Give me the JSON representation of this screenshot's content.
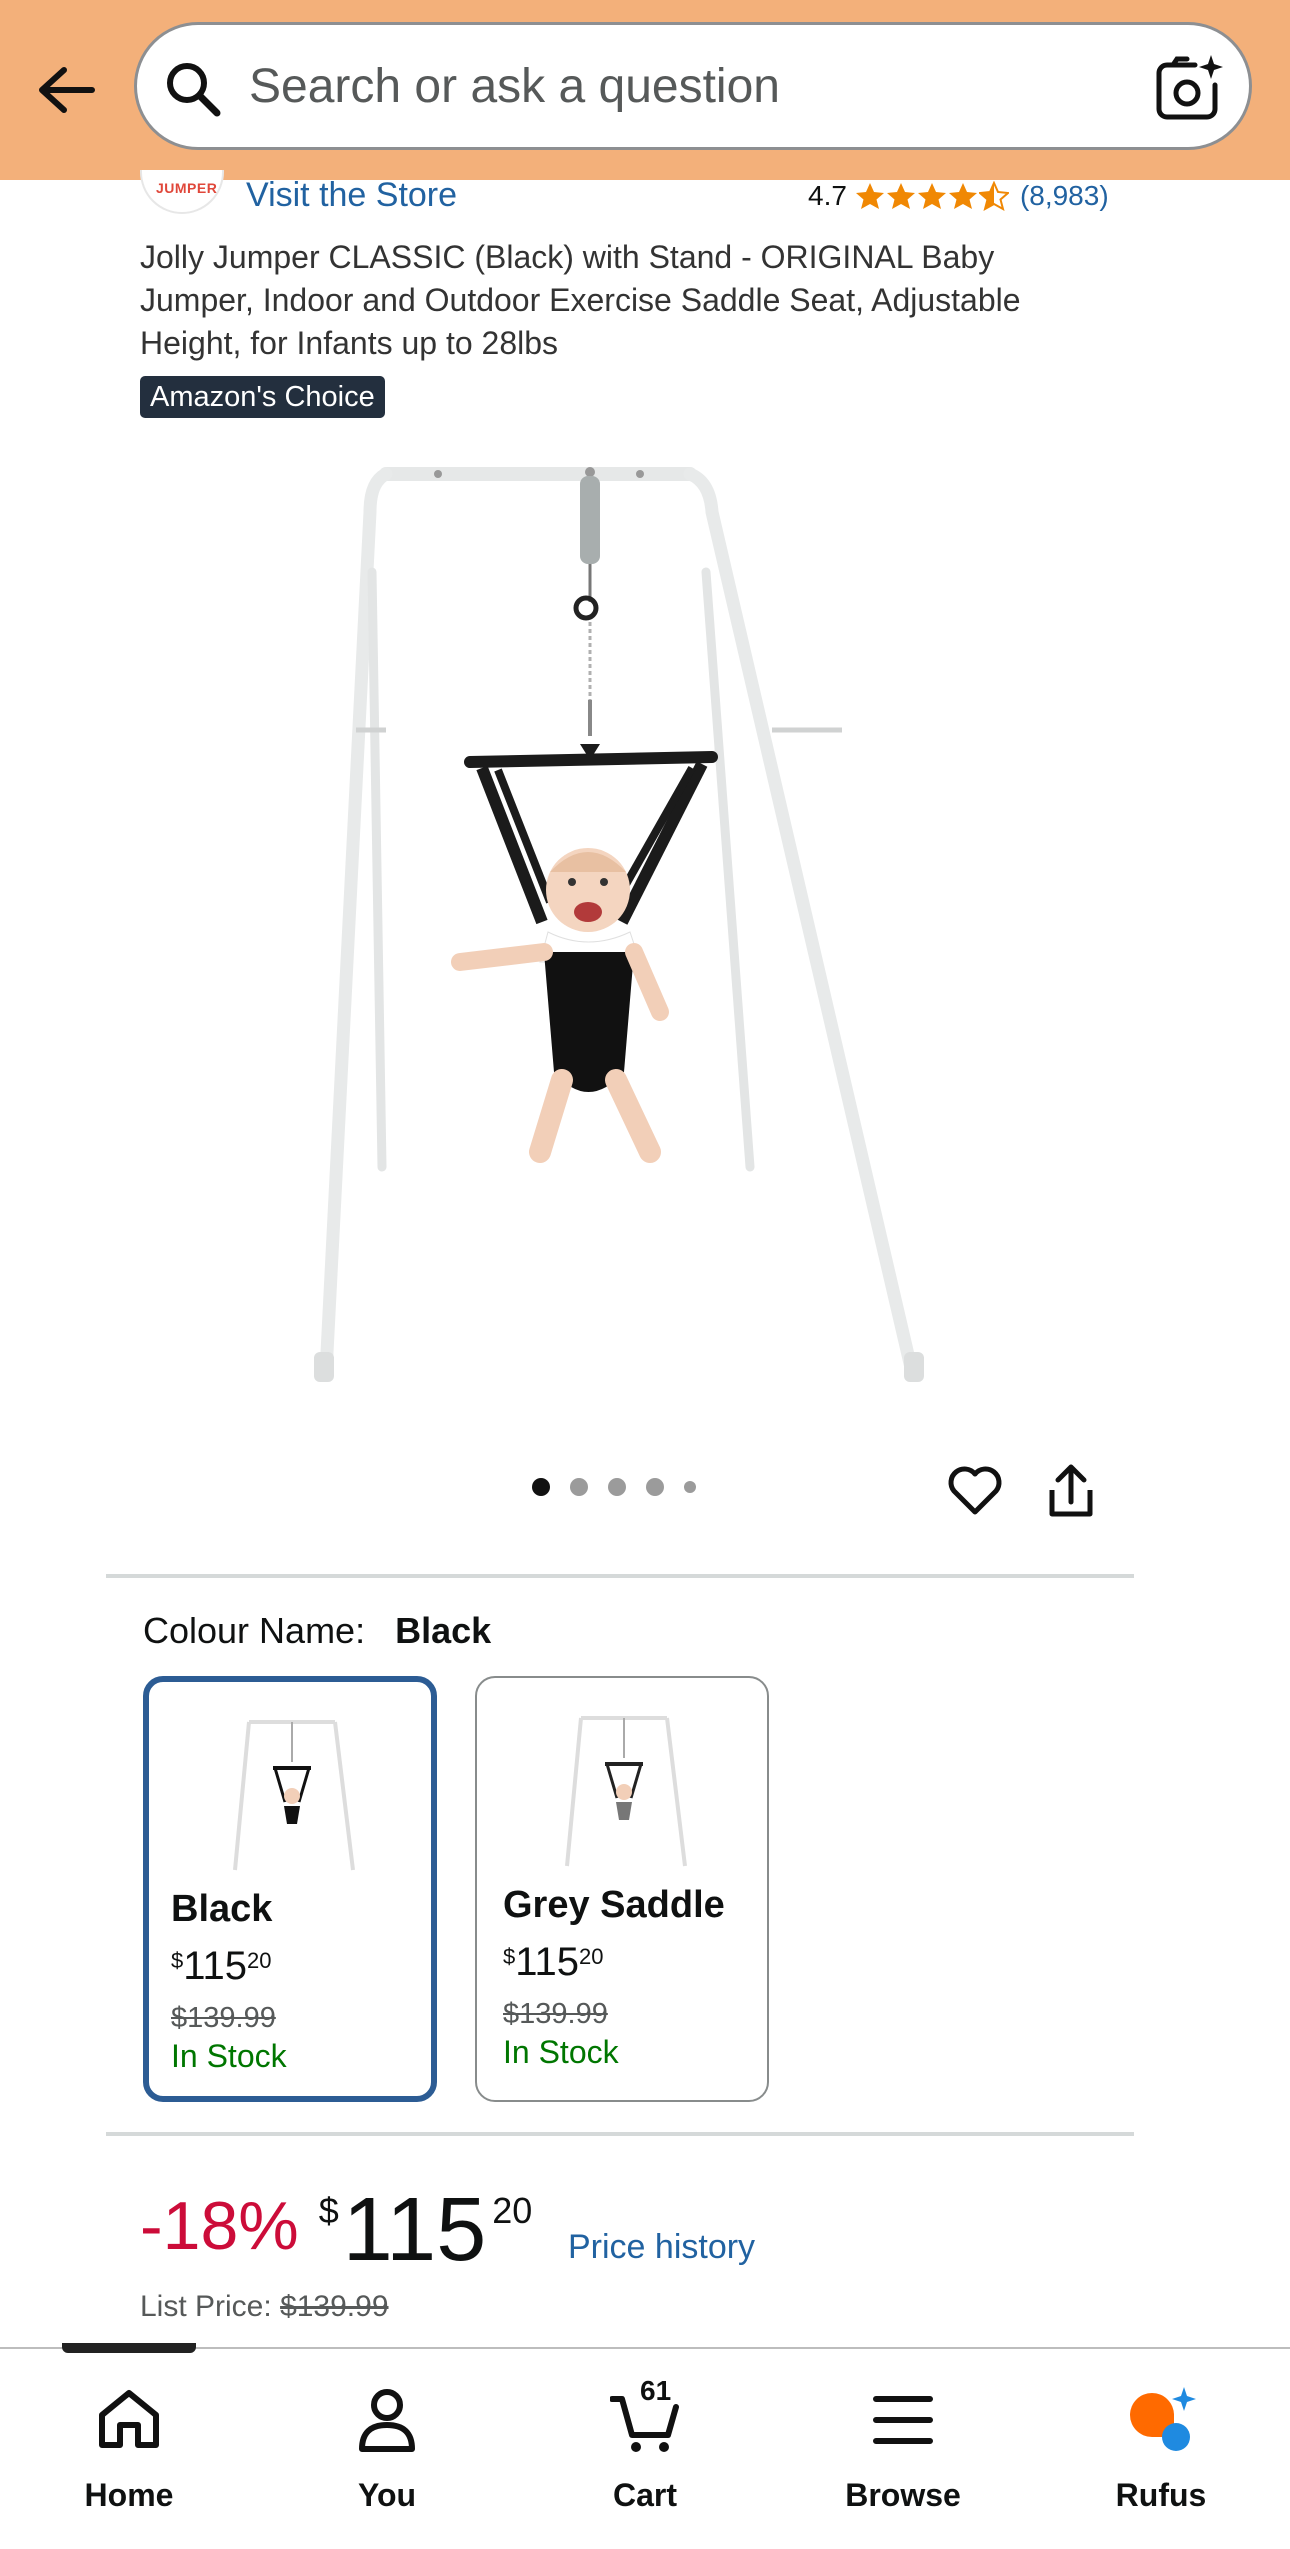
{
  "header": {
    "search_placeholder": "Search or ask a question"
  },
  "store": {
    "logo_text": "JUMPER",
    "visit_label": "Visit the Store",
    "rating": "4.7",
    "stars": 4.5,
    "rating_count": "(8,983)"
  },
  "product": {
    "title": "Jolly Jumper CLASSIC (Black) with Stand - ORIGINAL Baby Jumper, Indoor and Outdoor Exercise Saddle Seat, Adjustable Height, for Infants up to 28lbs",
    "badge": "Amazon's Choice",
    "carousel_dots": 5,
    "carousel_active": 1
  },
  "colour": {
    "label": "Colour Name:",
    "selected": "Black",
    "options": [
      {
        "name": "Black",
        "price_symbol": "$",
        "price_whole": "115",
        "price_fraction": "20",
        "list_price": "$139.99",
        "stock": "In Stock"
      },
      {
        "name": "Grey Saddle",
        "price_symbol": "$",
        "price_whole": "115",
        "price_fraction": "20",
        "list_price": "$139.99",
        "stock": "In Stock"
      }
    ]
  },
  "price": {
    "discount": "-18%",
    "symbol": "$",
    "whole": "115",
    "fraction": "20",
    "history_link": "Price history",
    "list_label": "List Price:",
    "list_value": "$139.99"
  },
  "nav": {
    "items": [
      {
        "label": "Home",
        "icon": "home-icon"
      },
      {
        "label": "You",
        "icon": "person-icon"
      },
      {
        "label": "Cart",
        "icon": "cart-icon"
      },
      {
        "label": "Browse",
        "icon": "menu-icon"
      },
      {
        "label": "Rufus",
        "icon": "rufus-icon"
      }
    ],
    "cart_count": "61"
  },
  "colors": {
    "header_bg": "#f3b07a",
    "link": "#2162a1",
    "discount": "#cc0c39",
    "in_stock": "#007600",
    "selected_border": "#2c5c94",
    "star": "#f08804"
  }
}
